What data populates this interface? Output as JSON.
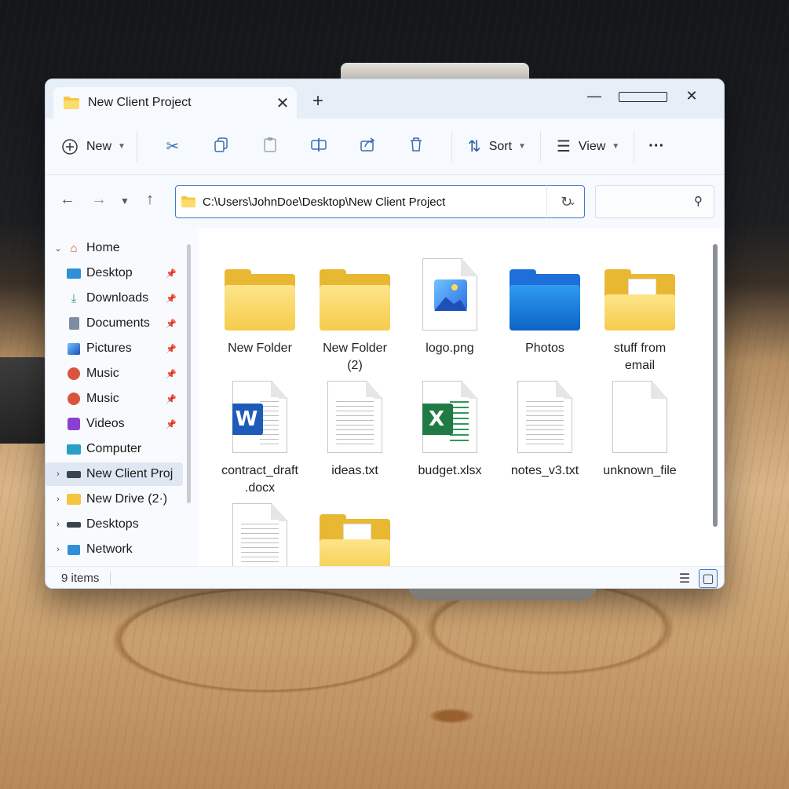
{
  "window": {
    "tab_title": "New Client Project",
    "new_tab_glyph": "+",
    "close_glyph": "✕"
  },
  "window_controls": {
    "minimize": "—",
    "close": "✕"
  },
  "commandbar": {
    "new_label": "New",
    "sort_label": "Sort",
    "view_label": "View",
    "more_label": "···"
  },
  "addressbar": {
    "path": "C:\\Users\\JohnDoe\\Desktop\\New Client Project",
    "search_placeholder": ""
  },
  "sidebar": {
    "items": [
      {
        "label": "Home",
        "icon": "home-icon"
      },
      {
        "label": "Desktop",
        "icon": "desktop-icon"
      },
      {
        "label": "Downloads",
        "icon": "download-icon"
      },
      {
        "label": "Documents",
        "icon": "documents-icon"
      },
      {
        "label": "Pictures",
        "icon": "pictures-icon"
      },
      {
        "label": "Music",
        "icon": "music-icon"
      },
      {
        "label": "Music",
        "icon": "music-icon"
      },
      {
        "label": "Videos",
        "icon": "videos-icon"
      },
      {
        "label": "Computer",
        "icon": "computer-icon"
      },
      {
        "label": "New Client Proj",
        "icon": "drive-icon"
      },
      {
        "label": "New Drive (2·)",
        "icon": "folder-icon"
      },
      {
        "label": "Desktops",
        "icon": "drive-icon"
      },
      {
        "label": "Network",
        "icon": "network-icon"
      }
    ]
  },
  "files": [
    {
      "name": "New Folder",
      "type": "folder"
    },
    {
      "name": "New Folder\n(2)",
      "type": "folder"
    },
    {
      "name": "logo.png",
      "type": "image"
    },
    {
      "name": "Photos",
      "type": "photos-folder"
    },
    {
      "name": "stuff from\nemail",
      "type": "folder-with-files"
    },
    {
      "name": "contract_draft\n.docx",
      "type": "word"
    },
    {
      "name": "ideas.txt",
      "type": "text"
    },
    {
      "name": "budget.xlsx",
      "type": "excel"
    },
    {
      "name": "notes_v3.txt",
      "type": "text"
    },
    {
      "name": "unknown_file",
      "type": "blank"
    },
    {
      "name": "",
      "type": "text"
    },
    {
      "name": "",
      "type": "folder-with-files"
    }
  ],
  "status": {
    "item_count": "9 items"
  },
  "colors": {
    "accent": "#3b78c9",
    "folder": "#f5cc4c",
    "word": "#1e5bb8",
    "excel": "#1f7a45"
  }
}
